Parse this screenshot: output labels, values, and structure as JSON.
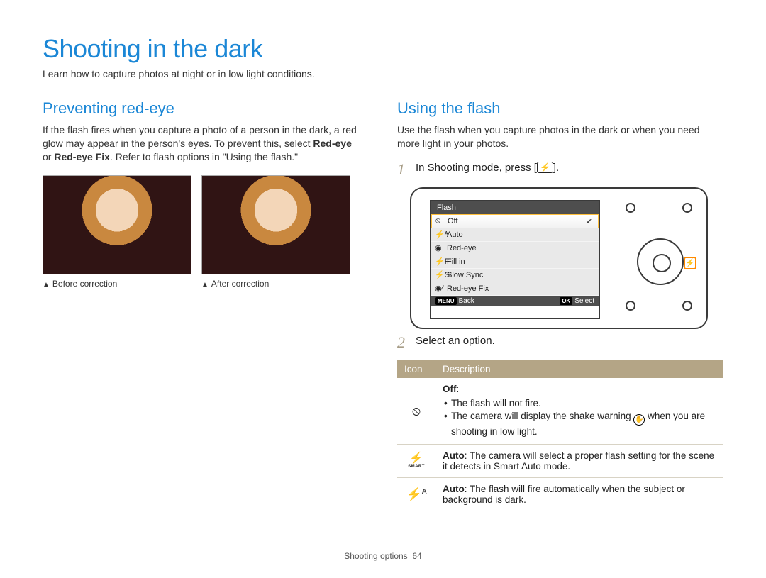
{
  "title": "Shooting in the dark",
  "subtitle": "Learn how to capture photos at night or in low light conditions.",
  "left": {
    "heading": "Preventing red-eye",
    "para_a": "If the flash fires when you capture a photo of a person in the dark, a red glow may appear in the person's eyes. To prevent this, select ",
    "red_eye": "Red-eye",
    "para_b": " or ",
    "red_eye_fix": "Red-eye Fix",
    "para_c": ". Refer to flash options in \"Using the flash.\"",
    "before_caption": "Before correction",
    "after_caption": "After correction"
  },
  "right": {
    "heading": "Using the flash",
    "para": "Use the flash when you capture photos in the dark or when you need more light in your photos.",
    "step1_a": "In Shooting mode, press [",
    "step1_glyph": "⚡",
    "step1_b": "].",
    "step2": "Select an option.",
    "screen": {
      "title": "Flash",
      "items": [
        {
          "glyph": "⦸",
          "label": "Off",
          "selected": true
        },
        {
          "glyph": "⚡ᴬ",
          "label": "Auto"
        },
        {
          "glyph": "◉",
          "label": "Red-eye"
        },
        {
          "glyph": "⚡F",
          "label": "Fill in"
        },
        {
          "glyph": "⚡S",
          "label": "Slow Sync"
        },
        {
          "glyph": "◉⁄",
          "label": "Red-eye Fix"
        }
      ],
      "foot_back_key": "MENU",
      "foot_back": "Back",
      "foot_select_key": "OK",
      "foot_select": "Select"
    },
    "table": {
      "col_icon": "Icon",
      "col_desc": "Description",
      "row1": {
        "title": "Off",
        "b1": "The flash will not fire.",
        "b2a": "The camera will display the shake warning ",
        "b2b": " when you are shooting in low light."
      },
      "row2": {
        "title": "Auto",
        "rest": ": The camera will select a proper flash setting for the scene it detects in Smart Auto mode.",
        "smart_label": "SMART"
      },
      "row3": {
        "title": "Auto",
        "rest": ": The flash will fire automatically when the subject or background is dark."
      }
    }
  },
  "footer": {
    "section": "Shooting options",
    "page": "64"
  }
}
